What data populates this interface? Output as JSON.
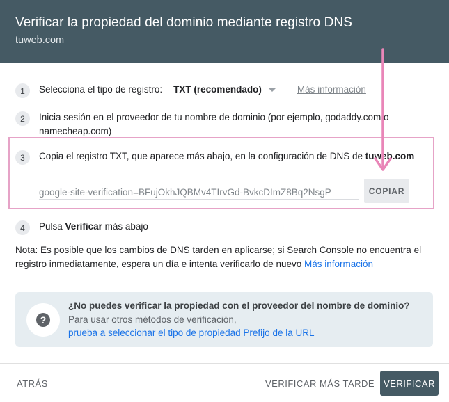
{
  "dialog": {
    "title": "Verificar la propiedad del dominio mediante registro DNS",
    "domain": "tuweb.com"
  },
  "steps": [
    {
      "number": "1",
      "text": "Selecciona el tipo de registro:",
      "select_value": "TXT (recomendado)",
      "link": "Más información"
    },
    {
      "number": "2",
      "line1": "Inicia sesión en el proveedor de tu nombre de dominio (por ejemplo, godaddy.com o",
      "line2": "namecheap.com)"
    },
    {
      "number": "3",
      "text": "Copia el registro TXT, que aparece más abajo, en la configuración de DNS de",
      "domain": "tuweb.com",
      "txt_record": "google-site-verification=BFujOkhJQBMv4TIrvGd-BvkcDImZ8Bq2NsgP",
      "copy_label": "COPIAR"
    },
    {
      "number": "4",
      "prefix": "Pulsa",
      "bold": "Verificar",
      "suffix": "más abajo"
    }
  ],
  "note": {
    "line1": "Nota: Es posible que los cambios de DNS tarden en aplicarse; si Search Console no encuentra el",
    "line2": "registro inmediatamente, espera un día e intenta verificarlo de nuevo",
    "link": "Más información"
  },
  "help_box": {
    "title": "¿No puedes verificar la propiedad con el proveedor del nombre de dominio?",
    "description": "Para usar otros métodos de verificación,",
    "link": "prueba a seleccionar el tipo de propiedad Prefijo de la URL",
    "icon": "help-icon"
  },
  "footer": {
    "back_label": "ATRÁS",
    "later_label": "VERIFICAR MÁS TARDE",
    "verify_label": "VERIFICAR"
  },
  "colors": {
    "header_bg": "#455a64",
    "link": "#1a73e8",
    "highlight_border": "#e6a3c7",
    "annotation_arrow": "#e986b8"
  }
}
